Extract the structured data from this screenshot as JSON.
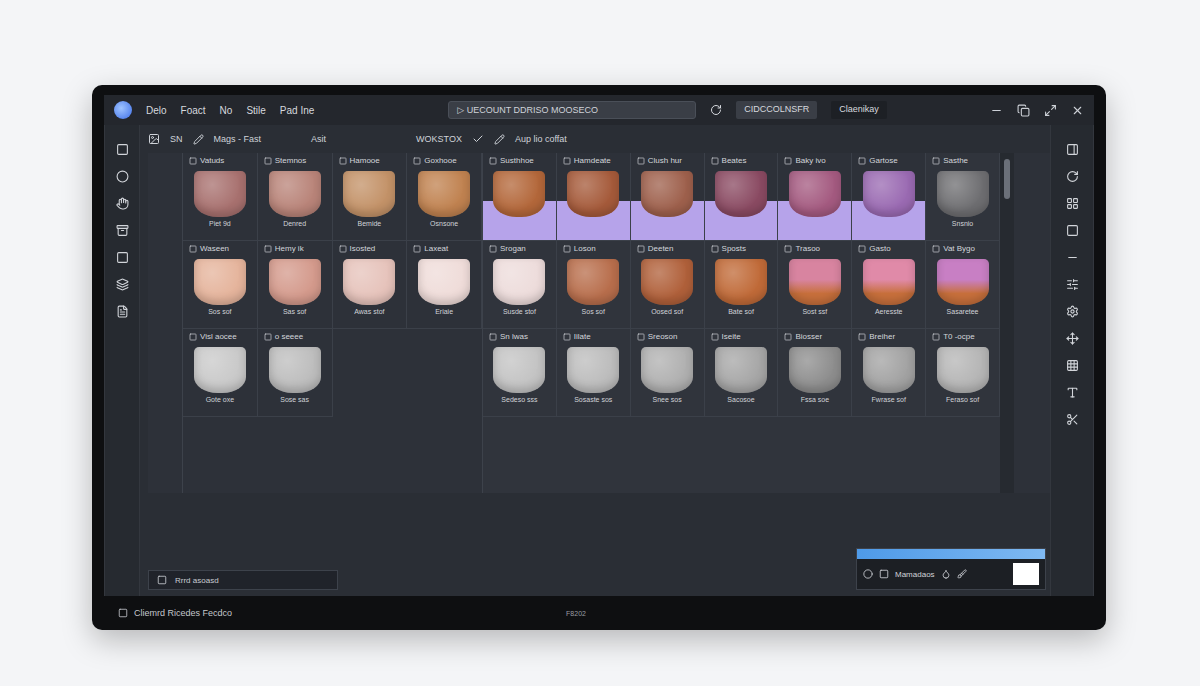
{
  "window": {
    "menu": [
      "Delo",
      "Foact",
      "No",
      "Stile",
      "Pad Ine"
    ],
    "address": "▷ UECOUNT DDRISO MOOSECO",
    "field": "CIDCCOLNSFR",
    "profile": "Claenikay"
  },
  "toolbar": {
    "left": [
      "SN",
      "Mags - Fast",
      "Asit"
    ],
    "center": [
      "WOKSTOX",
      "Aup lio coffat"
    ]
  },
  "panels": [
    {
      "name": "library",
      "rows": [
        [
          {
            "title": "Vatuds",
            "caption": "Piet 9d",
            "color": "#a8716f",
            "kind": "plain"
          },
          {
            "title": "Stemnos",
            "caption": "Denred",
            "color": "#b98479",
            "kind": "plain"
          },
          {
            "title": "Hamooe",
            "caption": "Bemide",
            "color": "#c39268",
            "kind": "plain"
          },
          {
            "title": "Goxhooe",
            "caption": "Osnsone",
            "color": "#c08250",
            "kind": "plain"
          }
        ],
        [
          {
            "title": "Waseen",
            "caption": "Sos sof",
            "color": "#e5b49c",
            "kind": "plain"
          },
          {
            "title": "Hemy ik",
            "caption": "Sas sof",
            "color": "#d49a8c",
            "kind": "plain"
          },
          {
            "title": "Isosted",
            "caption": "Awas stof",
            "color": "#e6c3bb",
            "kind": "plain"
          },
          {
            "title": "Laxeat",
            "caption": "Eriaie",
            "color": "#efdcd9",
            "kind": "plain"
          }
        ],
        [
          {
            "title": "Visl aocee",
            "caption": "Gote oxe",
            "color": "#c9c9c9",
            "kind": "plain"
          },
          {
            "title": "o seeee",
            "caption": "Sose sas",
            "color": "#bdbdbd",
            "kind": "plain"
          }
        ]
      ]
    },
    {
      "name": "preview",
      "rows": [
        [
          {
            "title": "Susthhoe",
            "color": "#b3673a",
            "kind": "backdrop"
          },
          {
            "title": "Hamdeate",
            "color": "#a55a3a",
            "kind": "backdrop"
          },
          {
            "title": "Clush hur",
            "color": "#9e604c",
            "kind": "backdrop"
          },
          {
            "title": "Beates",
            "color": "#8a4a62",
            "kind": "backdrop"
          },
          {
            "title": "Baky ivo",
            "color": "#a45a80",
            "kind": "backdrop"
          },
          {
            "title": "Gartose",
            "color": "#9a6ab2",
            "kind": "backdrop"
          },
          {
            "title": "Sasthe",
            "caption": "Snsnio",
            "color": "#6e6e71",
            "kind": "plain"
          }
        ],
        [
          {
            "title": "Srogan",
            "caption": "Susde stof",
            "color": "#eddcdb",
            "kind": "plain"
          },
          {
            "title": "Loson",
            "caption": "Sos sof",
            "color": "#b86e4c",
            "kind": "plain"
          },
          {
            "title": "Deeten",
            "caption": "Oosed sof",
            "color": "#b0603a",
            "kind": "plain"
          },
          {
            "title": "Sposts",
            "caption": "Bate sof",
            "color": "#c06a38",
            "kind": "plain"
          },
          {
            "title": "Trasoo",
            "caption": "Sost ssf",
            "color": "#d884a0",
            "kind": "ombre"
          },
          {
            "title": "Gasto",
            "caption": "Aeresste",
            "color": "#e08aa8",
            "kind": "ombre"
          },
          {
            "title": "Vat Bygo",
            "caption": "Sasaretee",
            "color": "#c87fc4",
            "kind": "ombre"
          }
        ],
        [
          {
            "title": "Sn lwas",
            "caption": "Sedeso sss",
            "color": "#c3c3c3",
            "kind": "plain"
          },
          {
            "title": "Iilate",
            "caption": "Sosaste sos",
            "color": "#bcbcbc",
            "kind": "plain"
          },
          {
            "title": "Sreoson",
            "caption": "Snee sos",
            "color": "#b0b0b0",
            "kind": "plain"
          },
          {
            "title": "Iseite",
            "caption": "Sacosoe",
            "color": "#a6a6a6",
            "kind": "plain"
          },
          {
            "title": "Biosser",
            "caption": "Fssa soe",
            "color": "#8d8d8d",
            "kind": "plain"
          },
          {
            "title": "Breiher",
            "caption": "Fwrase sof",
            "color": "#a2a2a2",
            "kind": "plain"
          },
          {
            "title": "T0 -ocpe",
            "caption": "Feraso sof",
            "color": "#b5b5b5",
            "kind": "plain"
          }
        ]
      ]
    }
  ],
  "status": {
    "text": "Rrrd asoasd",
    "panel": "Mamadaos"
  },
  "footer": {
    "label": "Cliemrd Ricedes Fecdco",
    "stand": "F8202"
  }
}
